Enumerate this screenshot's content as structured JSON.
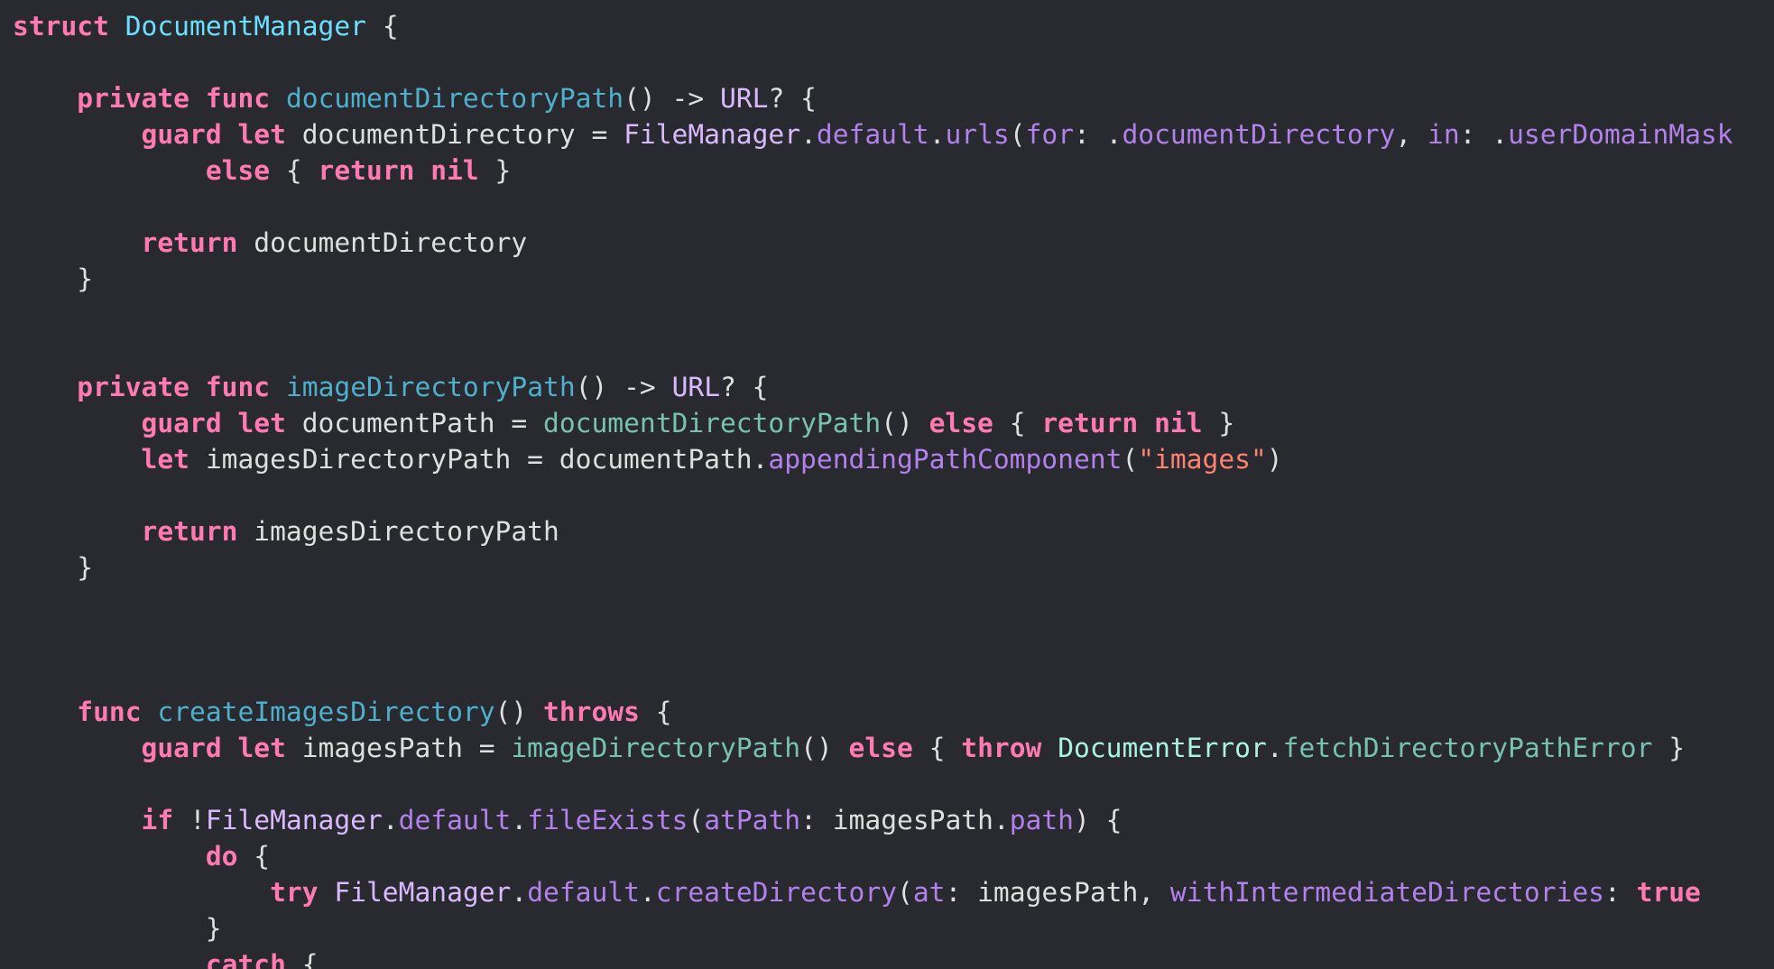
{
  "editor": {
    "lines": [
      [
        [
          "kw",
          "struct"
        ],
        [
          "plain",
          " "
        ],
        [
          "type-decl",
          "DocumentManager"
        ],
        [
          "plain",
          " {"
        ]
      ],
      [],
      [
        [
          "plain",
          "    "
        ],
        [
          "kw",
          "private"
        ],
        [
          "plain",
          " "
        ],
        [
          "kw",
          "func"
        ],
        [
          "plain",
          " "
        ],
        [
          "fn-decl",
          "documentDirectoryPath"
        ],
        [
          "plain",
          "() -> "
        ],
        [
          "systype",
          "URL"
        ],
        [
          "plain",
          "? {"
        ]
      ],
      [
        [
          "plain",
          "        "
        ],
        [
          "kw",
          "guard"
        ],
        [
          "plain",
          " "
        ],
        [
          "kw",
          "let"
        ],
        [
          "plain",
          " documentDirectory = "
        ],
        [
          "systype",
          "FileManager"
        ],
        [
          "plain",
          "."
        ],
        [
          "sys",
          "default"
        ],
        [
          "plain",
          "."
        ],
        [
          "sys",
          "urls"
        ],
        [
          "plain",
          "("
        ],
        [
          "sys",
          "for"
        ],
        [
          "plain",
          ": ."
        ],
        [
          "sys",
          "documentDirectory"
        ],
        [
          "plain",
          ", "
        ],
        [
          "sys",
          "in"
        ],
        [
          "plain",
          ": ."
        ],
        [
          "sys",
          "userDomainMask"
        ]
      ],
      [
        [
          "plain",
          "            "
        ],
        [
          "kw",
          "else"
        ],
        [
          "plain",
          " { "
        ],
        [
          "kw",
          "return"
        ],
        [
          "plain",
          " "
        ],
        [
          "kw",
          "nil"
        ],
        [
          "plain",
          " }"
        ]
      ],
      [],
      [
        [
          "plain",
          "        "
        ],
        [
          "kw",
          "return"
        ],
        [
          "plain",
          " documentDirectory"
        ]
      ],
      [
        [
          "plain",
          "    }"
        ]
      ],
      [],
      [],
      [
        [
          "plain",
          "    "
        ],
        [
          "kw",
          "private"
        ],
        [
          "plain",
          " "
        ],
        [
          "kw",
          "func"
        ],
        [
          "plain",
          " "
        ],
        [
          "fn-decl",
          "imageDirectoryPath"
        ],
        [
          "plain",
          "() -> "
        ],
        [
          "systype",
          "URL"
        ],
        [
          "plain",
          "? {"
        ]
      ],
      [
        [
          "plain",
          "        "
        ],
        [
          "kw",
          "guard"
        ],
        [
          "plain",
          " "
        ],
        [
          "kw",
          "let"
        ],
        [
          "plain",
          " documentPath = "
        ],
        [
          "call",
          "documentDirectoryPath"
        ],
        [
          "plain",
          "() "
        ],
        [
          "kw",
          "else"
        ],
        [
          "plain",
          " { "
        ],
        [
          "kw",
          "return"
        ],
        [
          "plain",
          " "
        ],
        [
          "kw",
          "nil"
        ],
        [
          "plain",
          " }"
        ]
      ],
      [
        [
          "plain",
          "        "
        ],
        [
          "kw",
          "let"
        ],
        [
          "plain",
          " imagesDirectoryPath = documentPath."
        ],
        [
          "sys",
          "appendingPathComponent"
        ],
        [
          "plain",
          "("
        ],
        [
          "str",
          "\"images\""
        ],
        [
          "plain",
          ")"
        ]
      ],
      [],
      [
        [
          "plain",
          "        "
        ],
        [
          "kw",
          "return"
        ],
        [
          "plain",
          " imagesDirectoryPath"
        ]
      ],
      [
        [
          "plain",
          "    }"
        ]
      ],
      [],
      [],
      [],
      [
        [
          "plain",
          "    "
        ],
        [
          "kw",
          "func"
        ],
        [
          "plain",
          " "
        ],
        [
          "fn-decl",
          "createImagesDirectory"
        ],
        [
          "plain",
          "() "
        ],
        [
          "kw",
          "throws"
        ],
        [
          "plain",
          " {"
        ]
      ],
      [
        [
          "plain",
          "        "
        ],
        [
          "kw",
          "guard"
        ],
        [
          "plain",
          " "
        ],
        [
          "kw",
          "let"
        ],
        [
          "plain",
          " imagesPath = "
        ],
        [
          "call",
          "imageDirectoryPath"
        ],
        [
          "plain",
          "() "
        ],
        [
          "kw",
          "else"
        ],
        [
          "plain",
          " { "
        ],
        [
          "kw",
          "throw"
        ],
        [
          "plain",
          " "
        ],
        [
          "projtype",
          "DocumentError"
        ],
        [
          "plain",
          "."
        ],
        [
          "call",
          "fetchDirectoryPathError"
        ],
        [
          "plain",
          " }"
        ]
      ],
      [],
      [
        [
          "plain",
          "        "
        ],
        [
          "kw",
          "if"
        ],
        [
          "plain",
          " !"
        ],
        [
          "systype",
          "FileManager"
        ],
        [
          "plain",
          "."
        ],
        [
          "sys",
          "default"
        ],
        [
          "plain",
          "."
        ],
        [
          "sys",
          "fileExists"
        ],
        [
          "plain",
          "("
        ],
        [
          "sys",
          "atPath"
        ],
        [
          "plain",
          ": imagesPath."
        ],
        [
          "sys",
          "path"
        ],
        [
          "plain",
          ") {"
        ]
      ],
      [
        [
          "plain",
          "            "
        ],
        [
          "kw",
          "do"
        ],
        [
          "plain",
          " {"
        ]
      ],
      [
        [
          "plain",
          "                "
        ],
        [
          "kw",
          "try"
        ],
        [
          "plain",
          " "
        ],
        [
          "systype",
          "FileManager"
        ],
        [
          "plain",
          "."
        ],
        [
          "sys",
          "default"
        ],
        [
          "plain",
          "."
        ],
        [
          "sys",
          "createDirectory"
        ],
        [
          "plain",
          "("
        ],
        [
          "sys",
          "at"
        ],
        [
          "plain",
          ": imagesPath, "
        ],
        [
          "sys",
          "withIntermediateDirectories"
        ],
        [
          "plain",
          ": "
        ],
        [
          "kw",
          "true"
        ]
      ],
      [
        [
          "plain",
          "            }"
        ]
      ],
      [
        [
          "plain",
          "            "
        ],
        [
          "kw",
          "catch"
        ],
        [
          "plain",
          " {"
        ]
      ]
    ]
  }
}
